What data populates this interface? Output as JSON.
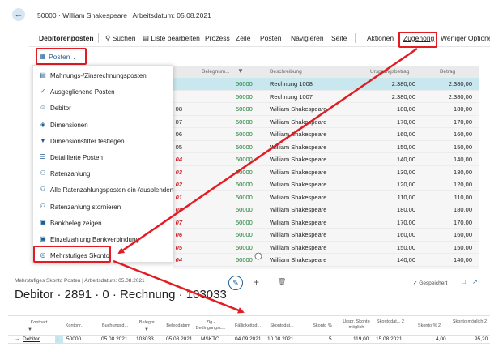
{
  "header": {
    "breadcrumb": "50000 · William Shakespeare | Arbeitsdatum: 05.08.2021"
  },
  "actionbar": {
    "title": "Debitorenposten",
    "items": [
      "Suchen",
      "Liste bearbeiten",
      "Prozess",
      "Zeile",
      "Posten",
      "Navigieren",
      "Seite",
      "Aktionen",
      "Zugehörig",
      "Weniger Optionen"
    ]
  },
  "posten_button": "Posten",
  "menu": {
    "items": [
      {
        "label": "Mahnungs-/Zinsrechnungsposten",
        "icon": "document-icon"
      },
      {
        "label": "Ausgeglichene Posten",
        "icon": "checkmark-icon"
      },
      {
        "label": "Debitor",
        "icon": "person-icon"
      },
      {
        "label": "Dimensionen",
        "icon": "dimensions-icon"
      },
      {
        "label": "Dimensionsfilter festlegen...",
        "icon": "filter-icon"
      },
      {
        "label": "Detaillierte Posten",
        "icon": "list-icon"
      },
      {
        "label": "Ratenzahlung",
        "icon": "people-icon"
      },
      {
        "label": "Alle Ratenzahlungsposten ein-/ausblenden",
        "icon": "people-icon"
      },
      {
        "label": "Ratenzahlung stornieren",
        "icon": "people-icon"
      },
      {
        "label": "Bankbeleg zeigen",
        "icon": "bank-icon"
      },
      {
        "label": "Einzelzahlung Bankverbindung",
        "icon": "bank-icon"
      },
      {
        "label": "Mehrstufiges Skonto",
        "icon": "globe-icon"
      }
    ]
  },
  "grid": {
    "columns": [
      "Belegnum...",
      "",
      "Beschreibung",
      "Ursprungsbetrag",
      "Betrag"
    ],
    "left_fragments": [
      {
        "text": "",
        "red": false
      },
      {
        "text": "",
        "red": false
      },
      {
        "text": "08",
        "red": false
      },
      {
        "text": "07",
        "red": false
      },
      {
        "text": "06",
        "red": false
      },
      {
        "text": "05",
        "red": false
      },
      {
        "text": "04",
        "red": true
      },
      {
        "text": "03",
        "red": true
      },
      {
        "text": "02",
        "red": true
      },
      {
        "text": "01",
        "red": true
      },
      {
        "text": "08",
        "red": true
      },
      {
        "text": "07",
        "red": true
      },
      {
        "text": "06",
        "red": true
      },
      {
        "text": "05",
        "red": true
      },
      {
        "text": "04",
        "red": true
      }
    ],
    "rows": [
      {
        "debitor": "50000",
        "desc": "Rechnung 1008",
        "orig": "2.380,00",
        "amount": "2.380,00",
        "selected": true
      },
      {
        "debitor": "50000",
        "desc": "Rechnung 1007",
        "orig": "2.380,00",
        "amount": "2.380,00",
        "selected": false
      },
      {
        "debitor": "50000",
        "desc": "William Shakespeare",
        "orig": "180,00",
        "amount": "180,00",
        "selected": false
      },
      {
        "debitor": "50000",
        "desc": "William Shakespeare",
        "orig": "170,00",
        "amount": "170,00",
        "selected": false
      },
      {
        "debitor": "50000",
        "desc": "William Shakespeare",
        "orig": "160,00",
        "amount": "160,00",
        "selected": false
      },
      {
        "debitor": "50000",
        "desc": "William Shakespeare",
        "orig": "150,00",
        "amount": "150,00",
        "selected": false
      },
      {
        "debitor": "50000",
        "desc": "William Shakespeare",
        "orig": "140,00",
        "amount": "140,00",
        "selected": false
      },
      {
        "debitor": "50000",
        "desc": "William Shakespeare",
        "orig": "130,00",
        "amount": "130,00",
        "selected": false
      },
      {
        "debitor": "50000",
        "desc": "William Shakespeare",
        "orig": "120,00",
        "amount": "120,00",
        "selected": false
      },
      {
        "debitor": "50000",
        "desc": "William Shakespeare",
        "orig": "110,00",
        "amount": "110,00",
        "selected": false
      },
      {
        "debitor": "50000",
        "desc": "William Shakespeare",
        "orig": "180,00",
        "amount": "180,00",
        "selected": false
      },
      {
        "debitor": "50000",
        "desc": "William Shakespeare",
        "orig": "170,00",
        "amount": "170,00",
        "selected": false
      },
      {
        "debitor": "50000",
        "desc": "William Shakespeare",
        "orig": "160,00",
        "amount": "160,00",
        "selected": false
      },
      {
        "debitor": "50000",
        "desc": "William Shakespeare",
        "orig": "150,00",
        "amount": "150,00",
        "selected": false
      },
      {
        "debitor": "50000",
        "desc": "William Shakespeare",
        "orig": "140,00",
        "amount": "140,00",
        "selected": false
      }
    ]
  },
  "panel": {
    "title": "Mehrstufiges Skonto Posten | Arbeitsdatum: 05.08.2021",
    "heading": "Debitor · 2891 · 0 · Rechnung · 103033",
    "saved": "Gespeichert",
    "columns": [
      "Kontoart",
      "Kontonr.",
      "Buchungsd...",
      "Belegnr.",
      "Belegdatum",
      "Zlg.-Bedingungsc...",
      "Fälligkeitsd...",
      "Skontodat...",
      "Skonto %",
      "Urspr. Skonto möglich",
      "Skontodat... 2",
      "Skonto % 2",
      "Skonto möglich 2"
    ],
    "row": {
      "kontoart": "Debitor",
      "kontonr": "50000",
      "buchungsdatum": "05.08.2021",
      "belegnr": "103033",
      "belegdatum": "05.08.2021",
      "zlg": "MSKTO",
      "faellig": "04.09.2021",
      "skontodat": "10.08.2021",
      "skonto_pct": "5",
      "urspr_skonto": "119,00",
      "skontodat2": "15.08.2021",
      "skonto_pct2": "4,00",
      "skonto_moegl2": "95,20"
    }
  },
  "colors": {
    "accent": "#1f5d96",
    "highlight_red": "#e31b23",
    "debitor_green": "#1c7e33",
    "selected_row": "#c9e7ee"
  }
}
